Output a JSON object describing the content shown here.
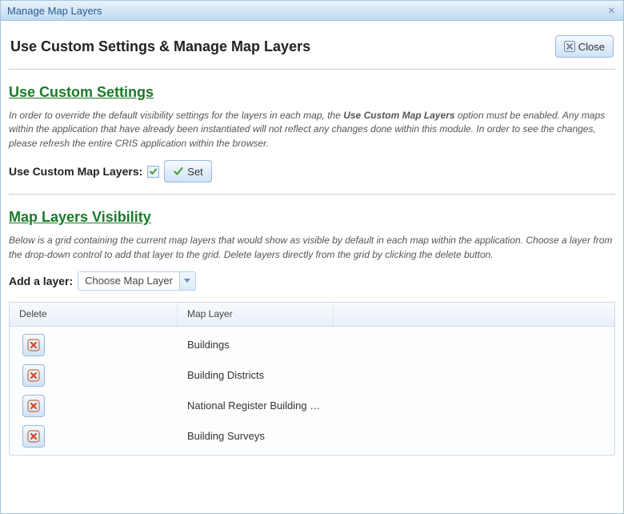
{
  "window": {
    "title": "Manage Map Layers"
  },
  "header": {
    "title": "Use Custom Settings & Manage Map Layers",
    "close_label": "Close"
  },
  "section1": {
    "heading": "Use Custom Settings",
    "desc_prefix": "In order to override the default visibility settings for the layers in each map, the ",
    "desc_bold": "Use Custom Map Layers",
    "desc_suffix": " option must be enabled. Any maps within the application that have already been instantiated will not reflect any changes done within this module. In order to see the changes, please refresh the entire CRIS application within the browser.",
    "checkbox_label": "Use Custom Map Layers:",
    "set_label": "Set"
  },
  "section2": {
    "heading": "Map Layers Visibility",
    "desc": "Below is a grid containing the current map layers that would show as visible by default in each map within the application. Choose a layer from the drop-down control to add that layer to the grid. Delete layers directly from the grid by clicking the delete button.",
    "add_label": "Add a layer:",
    "dropdown_text": "Choose Map Layer"
  },
  "grid": {
    "columns": {
      "delete": "Delete",
      "layer": "Map Layer"
    },
    "rows": [
      {
        "layer": "Buildings"
      },
      {
        "layer": "Building Districts"
      },
      {
        "layer": "National Register Building Listi..."
      },
      {
        "layer": "Building Surveys"
      }
    ]
  }
}
